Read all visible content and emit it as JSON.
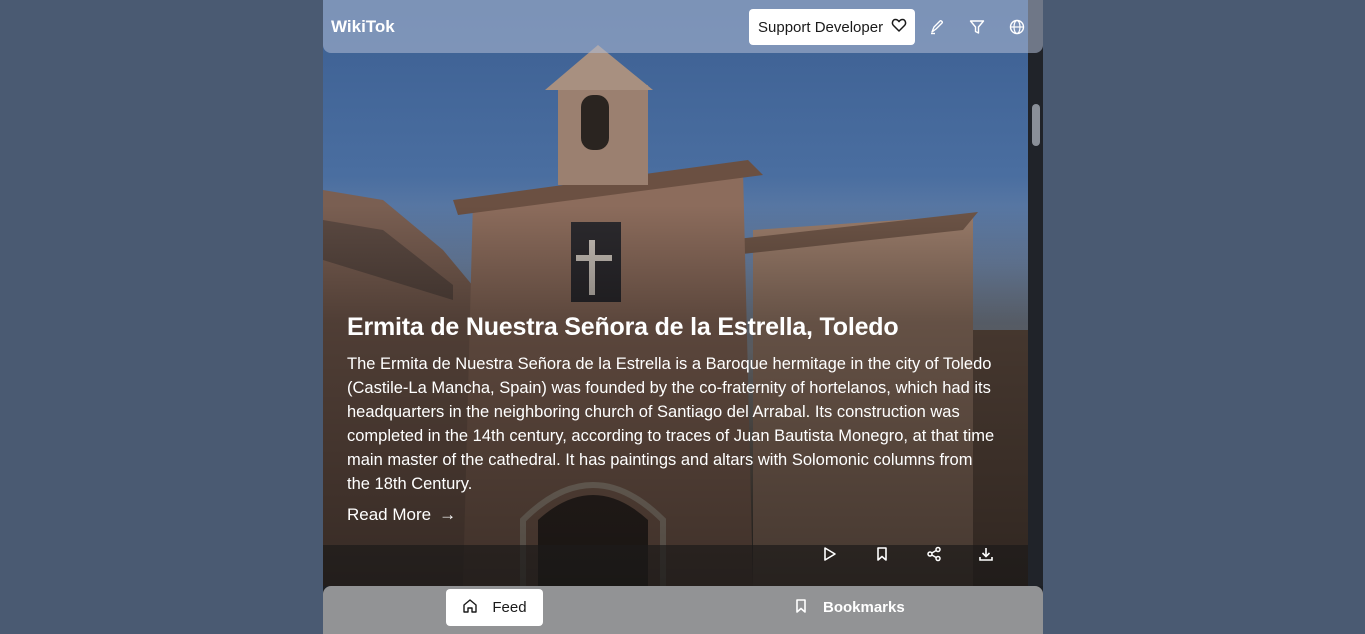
{
  "header": {
    "brand": "WikiTok",
    "support_label": "Support Developer",
    "icons": [
      "heart-icon",
      "pen-icon",
      "filter-icon",
      "globe-icon"
    ]
  },
  "article": {
    "title": "Ermita de Nuestra Señora de la Estrella, Toledo",
    "description": "The Ermita de Nuestra Señora de la Estrella is a Baroque hermitage in the city of Toledo (Castile-La Mancha, Spain) was founded by the co-fraternity of hortelanos, which had its headquarters in the neighboring church of Santiago del Arrabal. Its construction was completed in the 14th century, according to traces of Juan Bautista Monegro, at that time main master of the cathedral. It has paintings and altars with Solomonic columns from the 18th Century.",
    "read_more": "Read More",
    "read_more_arrow": "→"
  },
  "actions": [
    "play-icon",
    "bookmark-icon",
    "share-icon",
    "download-icon"
  ],
  "nav": {
    "feed_label": "Feed",
    "bookmarks_label": "Bookmarks"
  },
  "colors": {
    "page_bg": "#4a5a72",
    "header_bg": "#b0bed6",
    "sky": "#3c5f92",
    "brick": "#8a6e5c"
  }
}
